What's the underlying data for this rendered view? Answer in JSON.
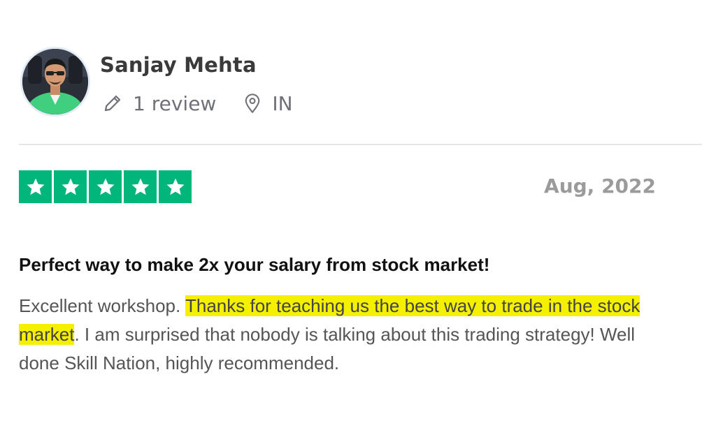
{
  "reviewer": {
    "name": "Sanjay Mehta",
    "review_count": "1 review",
    "country": "IN"
  },
  "rating": {
    "stars": 5,
    "max_stars": 5,
    "color": "#00b67a"
  },
  "date": "Aug, 2022",
  "review": {
    "title": "Perfect way to make 2x your salary from stock market!",
    "body_part1": "Excellent workshop. ",
    "body_highlight": "Thanks for teaching us the best way to trade in the stock market",
    "body_part2": ". I am surprised that nobody is talking about this trading strategy! Well done Skill Nation, highly recommended.",
    "highlight_color": "#f5f000"
  },
  "icons": {
    "review_count": "pencil-icon",
    "location": "map-pin-icon",
    "star": "star-icon"
  }
}
